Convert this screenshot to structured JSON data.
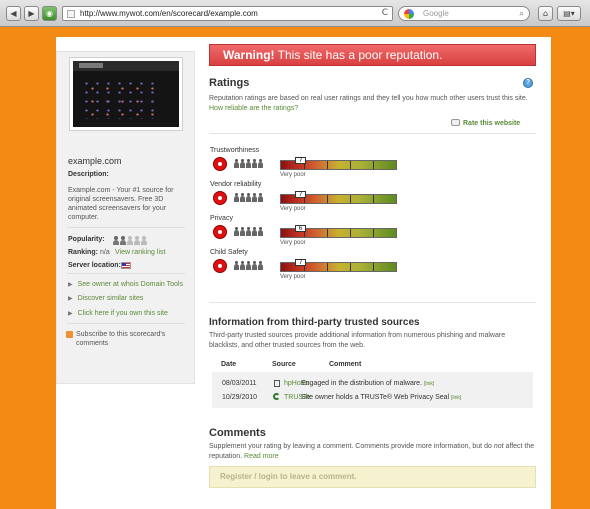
{
  "browser": {
    "back_label": "◀",
    "forward_label": "▶",
    "home_label": "⌂",
    "url": "http://www.mywot.com/en/scorecard/example.com",
    "reload_label": "C",
    "search_placeholder": "Google",
    "search_icon": "magnifier-icon"
  },
  "sidebar": {
    "site_name": "example.com",
    "description_label": "Description:",
    "description": "Example.com - Your #1 source for original screensavers. Free 3D animated screensavers for your computer.",
    "popularity_label": "Popularity:",
    "popularity_level": 2,
    "ranking_label": "Ranking:",
    "ranking_value": "n/a",
    "ranking_link": "View ranking list",
    "server_location_label": "Server location:",
    "links": [
      "See owner at whois Domain Tools",
      "Discover similar sites",
      "Click here if you own this site"
    ],
    "subscribe": "Subscribe to this scorecard's comments"
  },
  "warning": {
    "strong": "Warning!",
    "text": " This site has a poor reputation."
  },
  "ratings": {
    "title": "Ratings",
    "intro": "Reputation ratings are based on real user ratings and they tell you how much other users trust this site. ",
    "intro_link": "How reliable are the ratings?",
    "rate_link": "Rate this website",
    "categories": [
      {
        "label": "Trustworthiness",
        "score": "7",
        "verdict": "Very poor"
      },
      {
        "label": "Vendor reliability",
        "score": "7",
        "verdict": "Very poor"
      },
      {
        "label": "Privacy",
        "score": "6",
        "verdict": "Very poor"
      },
      {
        "label": "Child Safety",
        "score": "7",
        "verdict": "Very poor"
      }
    ]
  },
  "third_party": {
    "title": "Information from third-party trusted sources",
    "intro": "Third-party trusted sources provide additional information from numerous phishing and malware blacklists, and other trusted sources from the web.",
    "headers": {
      "date": "Date",
      "source": "Source",
      "comment": "Comment"
    },
    "rows": [
      {
        "date": "08/03/2011",
        "source": "hpHosts",
        "comment": "Engaged in the distribution of malware.",
        "link": "[link]"
      },
      {
        "date": "10/29/2010",
        "source": "TRUSTe",
        "comment": "Site owner holds a TRUSTe® Web Privacy Seal",
        "link": "[link]"
      }
    ]
  },
  "comments": {
    "title": "Comments",
    "intro_a": "Supplement your rating by leaving a comment. Comments provide more information, but do ",
    "intro_em": "not",
    "intro_b": " affect the reputation. ",
    "read_more": "Read more",
    "login": "Register / login to leave a comment."
  },
  "colors": {
    "background": "#f28a14",
    "warning": "#d84040",
    "link": "#5a8a36"
  }
}
